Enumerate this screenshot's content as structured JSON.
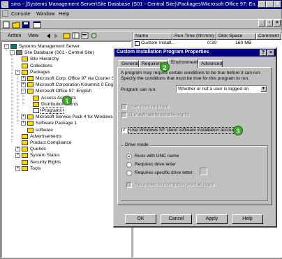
{
  "window": {
    "title": "sms - [Systems Management Server\\Site Database (S01 - Central Site)\\Packages\\Microsoft Office 97: En..."
  },
  "menu": {
    "items": [
      "Console",
      "Window",
      "Help"
    ]
  },
  "toolbar2": {
    "action": "Action",
    "view": "View"
  },
  "tree": {
    "items": [
      {
        "label": "Systems Management Server",
        "indent": 0
      },
      {
        "label": "Site Database (S01 - Central Site)",
        "indent": 1
      },
      {
        "label": "Site Hierarchy",
        "indent": 2
      },
      {
        "label": "Collections",
        "indent": 2
      },
      {
        "label": "Packages",
        "indent": 2
      },
      {
        "label": "Microsoft Corp. Office 97 via Courier Servi",
        "indent": 3
      },
      {
        "label": "Microsoft Corporation Kolumniz 0 English",
        "indent": 3
      },
      {
        "label": "Microsoft Office 97: English",
        "indent": 3
      },
      {
        "label": "Access Accounts",
        "indent": 4
      },
      {
        "label": "Distribution Points",
        "indent": 4
      },
      {
        "label": "Programs",
        "indent": 4
      },
      {
        "label": "Microsoft Service Pack 4 for Windows NT",
        "indent": 3
      },
      {
        "label": "Software Package 1",
        "indent": 3
      },
      {
        "label": "software",
        "indent": 3
      },
      {
        "label": "Advertisements",
        "indent": 2
      },
      {
        "label": "Product Compliance",
        "indent": 2
      },
      {
        "label": "Queries",
        "indent": 2
      },
      {
        "label": "System Status",
        "indent": 2
      },
      {
        "label": "Security Rights",
        "indent": 2
      },
      {
        "label": "Tools",
        "indent": 2
      }
    ]
  },
  "list": {
    "columns": [
      "Name",
      "Run Time (hh:mm)",
      "Disk Space",
      "Comment"
    ],
    "rows": [
      {
        "name": "Custom Install...",
        "run_time": "0:30",
        "disk_space": "160 MB",
        "comment": ""
      }
    ]
  },
  "dialog": {
    "title": "Custom Installation Program Properties",
    "help_btn": "?",
    "close_btn": "×",
    "tabs": [
      "General",
      "Requirements",
      "Environment",
      "Advanced"
    ],
    "active_tab": "Environment",
    "description": "A program may require certain conditions to be true before it can run. Specify the conditions that must be true for this program to run.",
    "program_can_run_label": "Program can run:",
    "program_can_run_value": "Whether or not a user is logged on",
    "chk_user_input": "User input required",
    "chk_admin_rights": "Run with administrative rights",
    "chk_nt_client": "Use Windows NT client software installation account",
    "drive_mode_label": "Drive mode",
    "radio_unc": "Runs with UNC name",
    "radio_drive_letter": "Requires drive letter",
    "radio_specific_drive": "Requires specific drive letter:",
    "chk_reconnect": "Reconnect to distribution point at logon",
    "buttons": {
      "ok": "OK",
      "cancel": "Cancel",
      "apply": "Apply",
      "help": "Help"
    }
  },
  "callouts": [
    "1",
    "2",
    "3"
  ]
}
